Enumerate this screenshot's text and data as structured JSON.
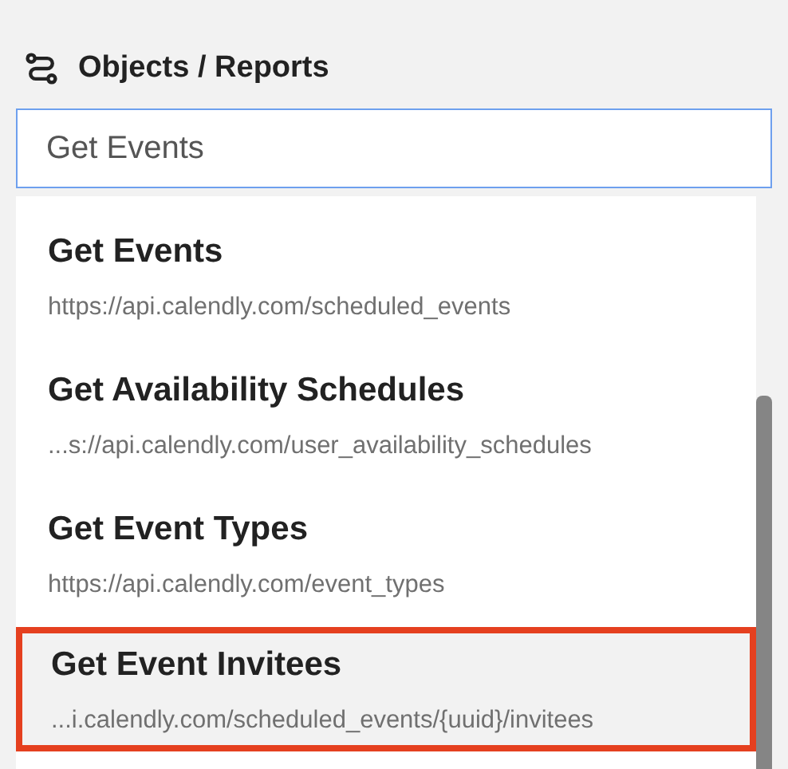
{
  "header": {
    "title": "Objects / Reports"
  },
  "search": {
    "value": "Get Events"
  },
  "results": [
    {
      "title": "Get Events",
      "url": "https://api.calendly.com/scheduled_events",
      "selected": false
    },
    {
      "title": "Get Availability Schedules",
      "url": "...s://api.calendly.com/user_availability_schedules",
      "selected": false
    },
    {
      "title": "Get Event Types",
      "url": "https://api.calendly.com/event_types",
      "selected": false
    },
    {
      "title": "Get Event Invitees",
      "url": "...i.calendly.com/scheduled_events/{uuid}/invitees",
      "selected": true
    }
  ]
}
